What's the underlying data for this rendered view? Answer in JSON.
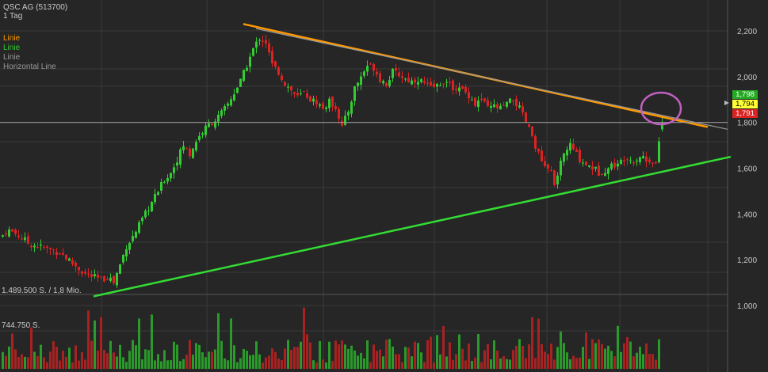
{
  "header": {
    "title": "QSC AG (513700)",
    "interval": "1 Tag"
  },
  "legend": [
    {
      "label": "Linie",
      "color": "#ff9900"
    },
    {
      "label": "Linie",
      "color": "#33cc33"
    },
    {
      "label": "Linie",
      "color": "#9a9a9a"
    },
    {
      "label": "Horizontal Line",
      "color": "#9a9a9a"
    }
  ],
  "volume": {
    "top_label": "1.489.500 S. / 1,8 Mio.",
    "mid_label": "744.750 S."
  },
  "price_badges": [
    {
      "value": "1,798",
      "bg": "#22aa22",
      "fg": "#ffffff"
    },
    {
      "value": "1,794",
      "bg": "#ffff33",
      "fg": "#000000"
    },
    {
      "value": "1,791",
      "bg": "#dd2222",
      "fg": "#ffffff"
    }
  ],
  "colors": {
    "up": "#33cc33",
    "down": "#dd2222",
    "triangle_upper": "#ff9900",
    "triangle_lower": "#33dd33",
    "gray_line": "#9a9a9a",
    "highlight_circle": "#c060c0",
    "grid": "#3a3a3a"
  },
  "chart_data": {
    "type": "candlestick",
    "title": "QSC AG (513700)",
    "interval": "1 Tag",
    "yticks": [
      "1,000",
      "1,200",
      "1,400",
      "1,600",
      "1,800",
      "2,000",
      "2,200"
    ],
    "ytick_values": [
      1.0,
      1.2,
      1.4,
      1.6,
      1.8,
      2.0,
      2.2
    ],
    "ylim": [
      0.95,
      2.25
    ],
    "price_points": [
      [
        0,
        1.3
      ],
      [
        8,
        1.33
      ],
      [
        15,
        1.32
      ],
      [
        25,
        1.3
      ],
      [
        35,
        1.27
      ],
      [
        45,
        1.26
      ],
      [
        55,
        1.25
      ],
      [
        65,
        1.24
      ],
      [
        75,
        1.23
      ],
      [
        85,
        1.2
      ],
      [
        95,
        1.17
      ],
      [
        105,
        1.14
      ],
      [
        112,
        1.13
      ],
      [
        120,
        1.12
      ],
      [
        128,
        1.11
      ],
      [
        135,
        1.13
      ],
      [
        142,
        1.1
      ],
      [
        150,
        1.18
      ],
      [
        158,
        1.26
      ],
      [
        166,
        1.3
      ],
      [
        174,
        1.35
      ],
      [
        182,
        1.4
      ],
      [
        190,
        1.45
      ],
      [
        198,
        1.5
      ],
      [
        206,
        1.55
      ],
      [
        214,
        1.58
      ],
      [
        222,
        1.64
      ],
      [
        230,
        1.7
      ],
      [
        238,
        1.66
      ],
      [
        246,
        1.72
      ],
      [
        254,
        1.76
      ],
      [
        262,
        1.79
      ],
      [
        270,
        1.81
      ],
      [
        278,
        1.84
      ],
      [
        286,
        1.88
      ],
      [
        294,
        1.93
      ],
      [
        302,
        1.98
      ],
      [
        310,
        2.05
      ],
      [
        318,
        2.12
      ],
      [
        326,
        2.17
      ],
      [
        334,
        2.15
      ],
      [
        342,
        2.05
      ],
      [
        350,
        2.02
      ],
      [
        358,
        1.97
      ],
      [
        366,
        1.94
      ],
      [
        374,
        1.91
      ],
      [
        382,
        1.93
      ],
      [
        390,
        1.9
      ],
      [
        398,
        1.89
      ],
      [
        406,
        1.86
      ],
      [
        414,
        1.89
      ],
      [
        422,
        1.87
      ],
      [
        430,
        1.78
      ],
      [
        438,
        1.85
      ],
      [
        446,
        1.95
      ],
      [
        454,
        2.0
      ],
      [
        462,
        2.05
      ],
      [
        470,
        2.04
      ],
      [
        478,
        1.99
      ],
      [
        486,
        1.97
      ],
      [
        494,
        2.02
      ],
      [
        502,
        2.01
      ],
      [
        510,
        1.99
      ],
      [
        518,
        1.98
      ],
      [
        526,
        1.99
      ],
      [
        534,
        1.97
      ],
      [
        542,
        1.95
      ],
      [
        550,
        1.96
      ],
      [
        558,
        1.98
      ],
      [
        566,
        1.96
      ],
      [
        574,
        1.95
      ],
      [
        582,
        1.94
      ],
      [
        590,
        1.92
      ],
      [
        598,
        1.88
      ],
      [
        606,
        1.9
      ],
      [
        614,
        1.86
      ],
      [
        622,
        1.87
      ],
      [
        630,
        1.86
      ],
      [
        638,
        1.88
      ],
      [
        646,
        1.9
      ],
      [
        654,
        1.86
      ],
      [
        662,
        1.8
      ],
      [
        670,
        1.74
      ],
      [
        678,
        1.66
      ],
      [
        686,
        1.6
      ],
      [
        694,
        1.58
      ],
      [
        700,
        1.52
      ],
      [
        706,
        1.62
      ],
      [
        712,
        1.68
      ],
      [
        718,
        1.7
      ],
      [
        724,
        1.67
      ],
      [
        730,
        1.64
      ],
      [
        736,
        1.62
      ],
      [
        742,
        1.61
      ],
      [
        748,
        1.6
      ],
      [
        754,
        1.58
      ],
      [
        760,
        1.59
      ],
      [
        766,
        1.6
      ],
      [
        772,
        1.62
      ],
      [
        778,
        1.61
      ],
      [
        784,
        1.64
      ],
      [
        790,
        1.65
      ],
      [
        796,
        1.63
      ],
      [
        802,
        1.64
      ],
      [
        808,
        1.66
      ],
      [
        814,
        1.63
      ],
      [
        820,
        1.64
      ],
      [
        826,
        1.62
      ],
      [
        834,
        1.79
      ]
    ],
    "trend_lines": [
      {
        "name": "Linie",
        "color": "#ff9900",
        "from": [
          307,
          2.23
        ],
        "to": [
          893,
          1.78
        ]
      },
      {
        "name": "Linie",
        "color": "#33dd33",
        "from": [
          118,
          1.04
        ],
        "to": [
          922,
          1.65
        ]
      },
      {
        "name": "Linie",
        "color": "#9a9a9a",
        "from": [
          323,
          2.21
        ],
        "to": [
          918,
          1.77
        ]
      },
      {
        "name": "Horizontal Line",
        "color": "#9a9a9a",
        "value": 1.8
      }
    ],
    "last_prices": [
      "1,798",
      "1,794",
      "1,791"
    ],
    "volume_labels": [
      "1.489.500 S. / 1,8 Mio.",
      "744.750 S."
    ],
    "volume_max": 1489500
  }
}
